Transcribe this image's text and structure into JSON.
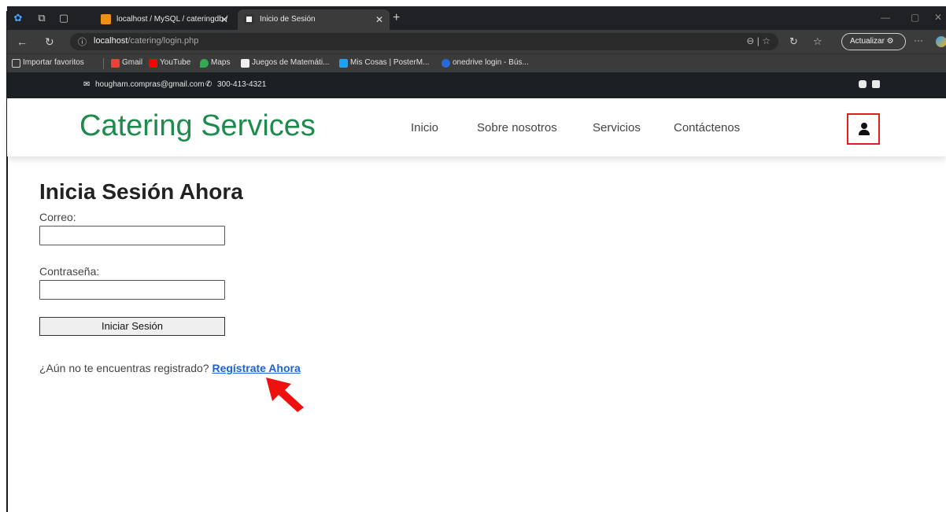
{
  "browser": {
    "tabs": [
      {
        "title": "localhost / MySQL / cateringdb /",
        "active": false
      },
      {
        "title": "Inicio de Sesión",
        "active": true
      }
    ],
    "url_host": "localhost",
    "url_path": "/catering/login.php",
    "update_button": "Actualizar",
    "favorites": [
      {
        "label": "Importar favoritos",
        "icon": "import-icon",
        "color": "#cfcfcf"
      },
      {
        "label": "Gmail",
        "icon": "gmail-icon",
        "color": "#ea4335"
      },
      {
        "label": "YouTube",
        "icon": "youtube-icon",
        "color": "#ff0000"
      },
      {
        "label": "Maps",
        "icon": "maps-icon",
        "color": "#34a853"
      },
      {
        "label": "Juegos de Matemáti...",
        "icon": "coolmath-icon",
        "color": "#f0f0f0"
      },
      {
        "label": "Mis Cosas | PosterM...",
        "icon": "postermywall-icon",
        "color": "#1da1f2"
      },
      {
        "label": "onedrive login - Bús...",
        "icon": "bing-icon",
        "color": "#2a6ad8"
      }
    ]
  },
  "topbar": {
    "email": "hougham.compras@gmail.com",
    "phone": "300-413-4321"
  },
  "header": {
    "brand": "Catering Services",
    "nav": [
      "Inicio",
      "Sobre nosotros",
      "Servicios",
      "Contáctenos"
    ],
    "accent": "#1e8a4c"
  },
  "login": {
    "title": "Inicia Sesión Ahora",
    "email_label": "Correo:",
    "password_label": "Contraseña:",
    "submit_label": "Iniciar Sesión",
    "register_prompt": "¿Aún no te encuentras registrado?",
    "register_link": "Regístrate Ahora"
  }
}
